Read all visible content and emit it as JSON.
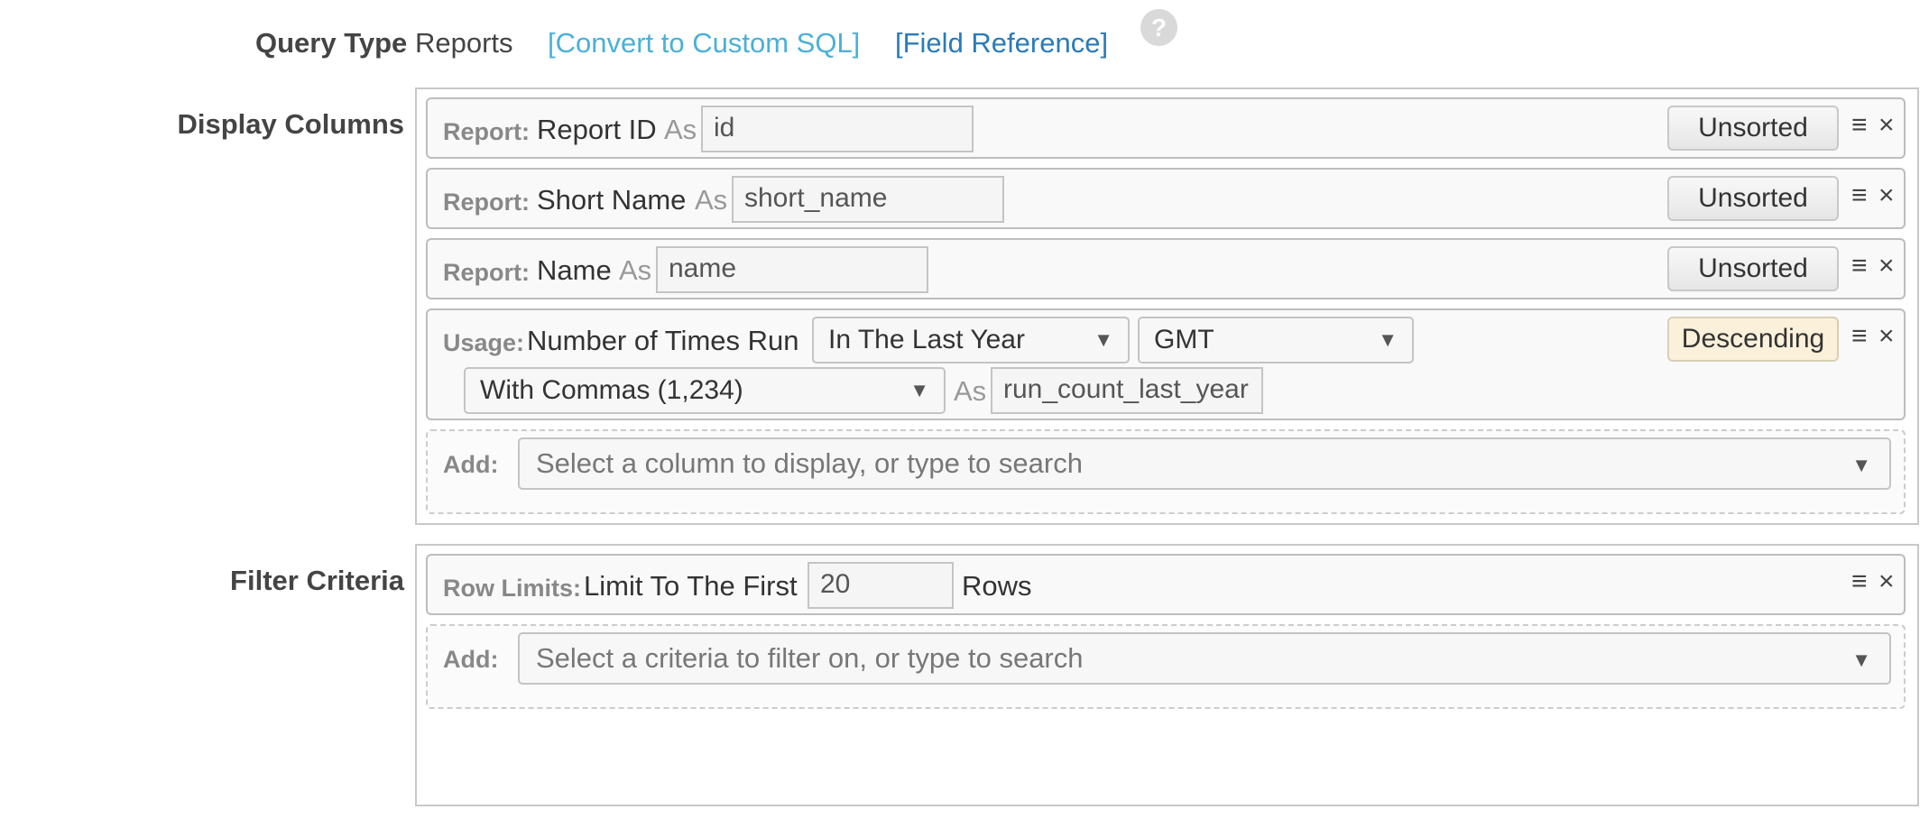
{
  "query_type": {
    "label": "Query Type",
    "value": "Reports",
    "convert_link": "[Convert to Custom SQL]",
    "field_reference_link": "[Field Reference]",
    "help_icon": "?"
  },
  "display_columns": {
    "label": "Display Columns",
    "rows": [
      {
        "category": "Report:",
        "field": "Report ID",
        "as": "As",
        "alias": "id",
        "sort": "Unsorted"
      },
      {
        "category": "Report:",
        "field": "Short Name",
        "as": "As",
        "alias": "short_name",
        "sort": "Unsorted"
      },
      {
        "category": "Report:",
        "field": "Name",
        "as": "As",
        "alias": "name",
        "sort": "Unsorted"
      },
      {
        "category": "Usage:",
        "field": "Number of Times Run",
        "period": "In The Last Year",
        "timezone": "GMT",
        "format": "With Commas (1,234)",
        "as": "As",
        "alias": "run_count_last_year",
        "sort": "Descending"
      }
    ],
    "add_label": "Add:",
    "add_placeholder": "Select a column to display, or type to search"
  },
  "filter_criteria": {
    "label": "Filter Criteria",
    "rows": [
      {
        "category": "Row Limits:",
        "prefix": "Limit To The First",
        "value": "20",
        "suffix": "Rows"
      }
    ],
    "add_label": "Add:",
    "add_placeholder": "Select a criteria to filter on, or type to search"
  },
  "controls": {
    "reorder_glyph": "≡",
    "remove_glyph": "×",
    "dropdown_glyph": "▼"
  },
  "colors": {
    "link_light": "#4ab0d9",
    "link_dark": "#2a7bb8",
    "descending_bg": "#fbf0d9"
  }
}
